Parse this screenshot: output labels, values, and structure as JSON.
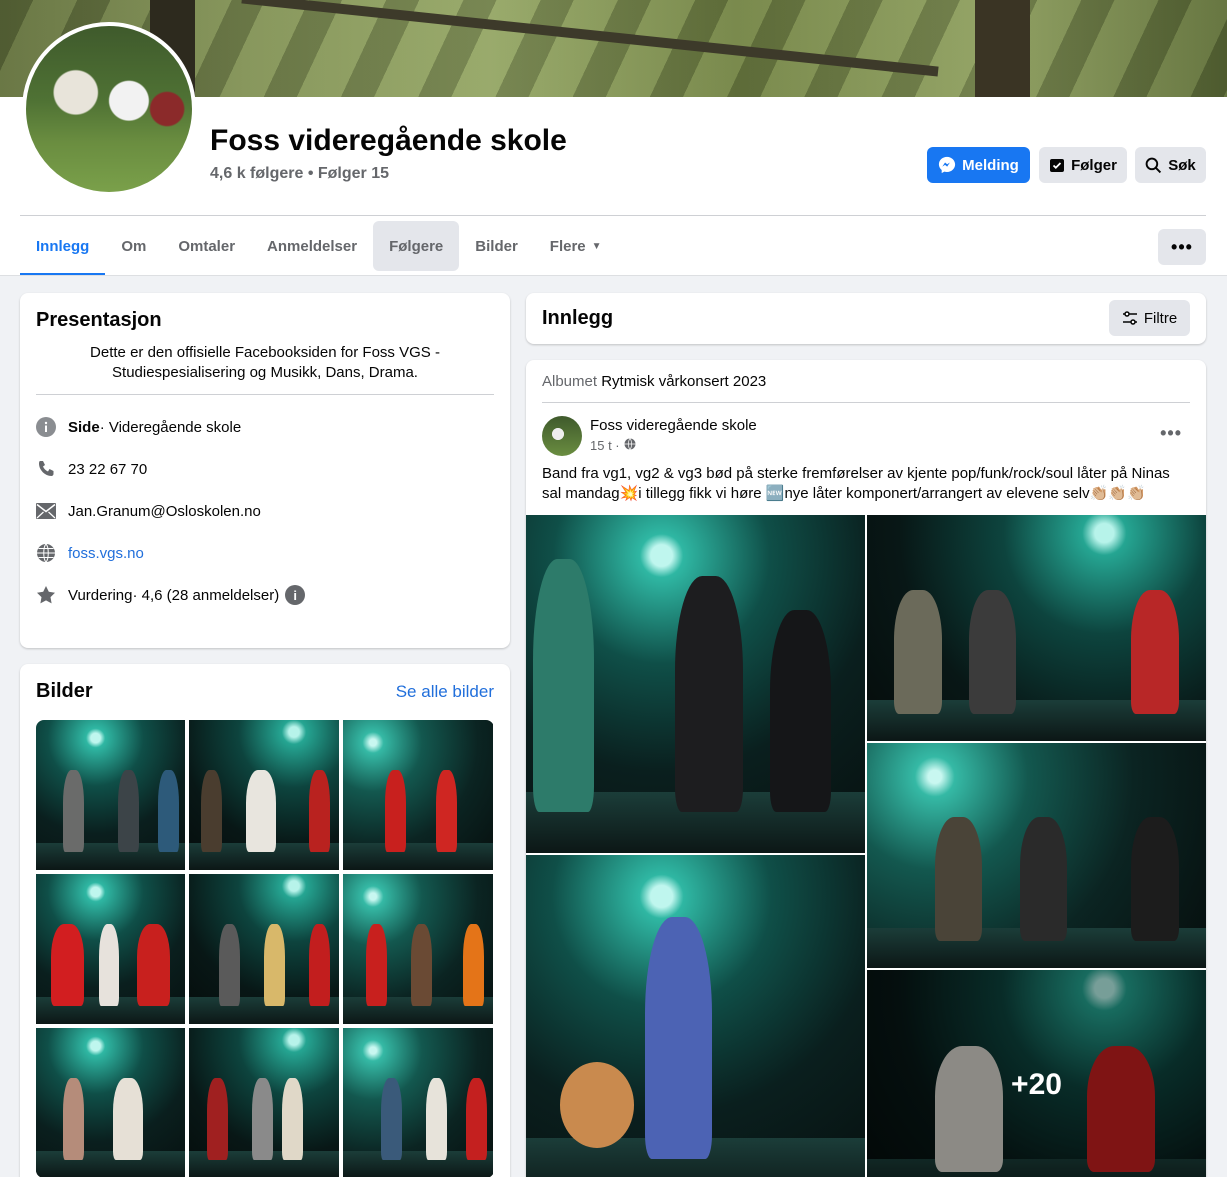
{
  "page": {
    "name": "Foss videregående skole",
    "followers_line": "4,6 k følgere • Følger 15"
  },
  "actions": {
    "message_label": "Melding",
    "follow_label": "Følger",
    "search_label": "Søk",
    "more_label": "•••"
  },
  "tabs": [
    {
      "label": "Innlegg"
    },
    {
      "label": "Om"
    },
    {
      "label": "Omtaler"
    },
    {
      "label": "Anmeldelser"
    },
    {
      "label": "Følgere"
    },
    {
      "label": "Bilder"
    },
    {
      "label": "Flere"
    }
  ],
  "intro": {
    "title": "Presentasjon",
    "text": "Dette er den offisielle Facebooksiden for Foss VGS - Studiespesialisering og Musikk, Dans, Drama.",
    "category_label": "Side",
    "category_value": " · Videregående skole",
    "phone": "23 22 67 70",
    "email": "Jan.Granum@Osloskolen.no",
    "website": "foss.vgs.no",
    "rating": "Vurdering· 4,6 (28 anmeldelser)"
  },
  "photos": {
    "title": "Bilder",
    "see_all": "Se alle bilder"
  },
  "posts": {
    "title": "Innlegg",
    "filter_label": "Filtre"
  },
  "post": {
    "album_prefix": "Albumet ",
    "album_name": "Rytmisk vårkonsert 2023",
    "author": "Foss videregående skole",
    "time": "15 t ·",
    "text": "Band fra vg1, vg2 & vg3 bød på sterke fremførelser av kjente pop/funk/rock/soul låter på Ninas sal mandag💥i tillegg fikk vi høre 🆕nye låter komponert/arrangert av elevene selv👏🏼👏🏼👏🏼",
    "more_photos": "+20",
    "menu": "•••"
  },
  "colors": {
    "accent": "#1877f2",
    "link": "#216fdb",
    "muted": "#65676b",
    "button_gray": "#e4e6eb"
  },
  "icons": [
    "messenger-icon",
    "follow-icon",
    "search-icon",
    "info-icon",
    "phone-icon",
    "mail-icon",
    "globe-icon",
    "star-icon",
    "filter-icon",
    "globe-small-icon"
  ]
}
